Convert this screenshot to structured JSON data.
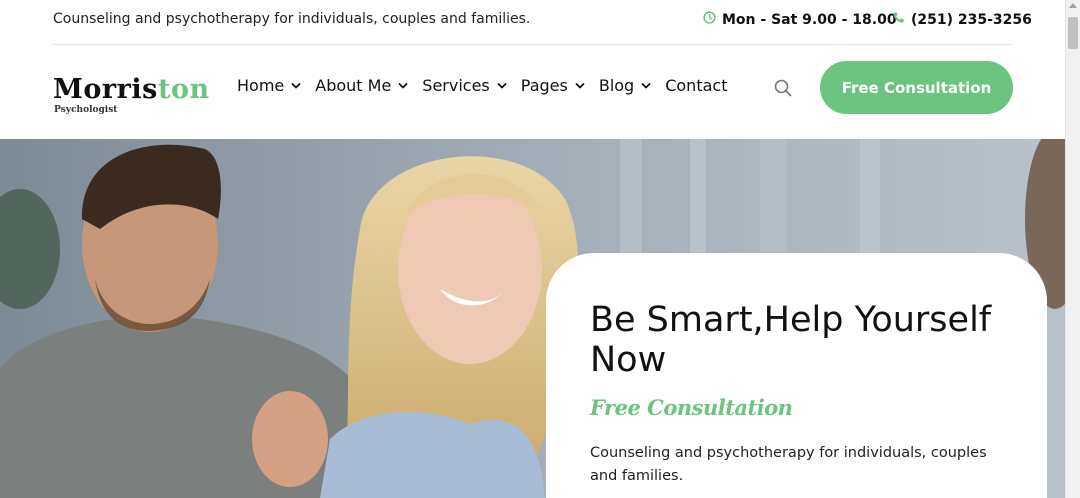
{
  "topbar": {
    "tagline": "Counseling and psychotherapy for individuals, couples and families.",
    "hours": "Mon - Sat 9.00 - 18.00",
    "phone": "(251) 235-3256",
    "hours_icon": "clock-icon",
    "phone_icon": "phone-icon"
  },
  "logo": {
    "word1": "Morris",
    "word2": "ton",
    "subtitle": "Psychologist"
  },
  "nav": {
    "items": [
      {
        "label": "Home",
        "has_dropdown": true
      },
      {
        "label": "About Me",
        "has_dropdown": true
      },
      {
        "label": "Services",
        "has_dropdown": true
      },
      {
        "label": "Pages",
        "has_dropdown": true
      },
      {
        "label": "Blog",
        "has_dropdown": true
      },
      {
        "label": "Contact",
        "has_dropdown": false
      }
    ],
    "search_icon": "search-icon",
    "cta_label": "Free Consultation"
  },
  "hero": {
    "heading": "Be Smart,Help Yourself Now",
    "script_label": "Free Consultation",
    "description": "Counseling and psychotherapy for individuals, couples and families."
  },
  "colors": {
    "accent": "#6cc47e",
    "text": "#111111",
    "background": "#ffffff"
  }
}
